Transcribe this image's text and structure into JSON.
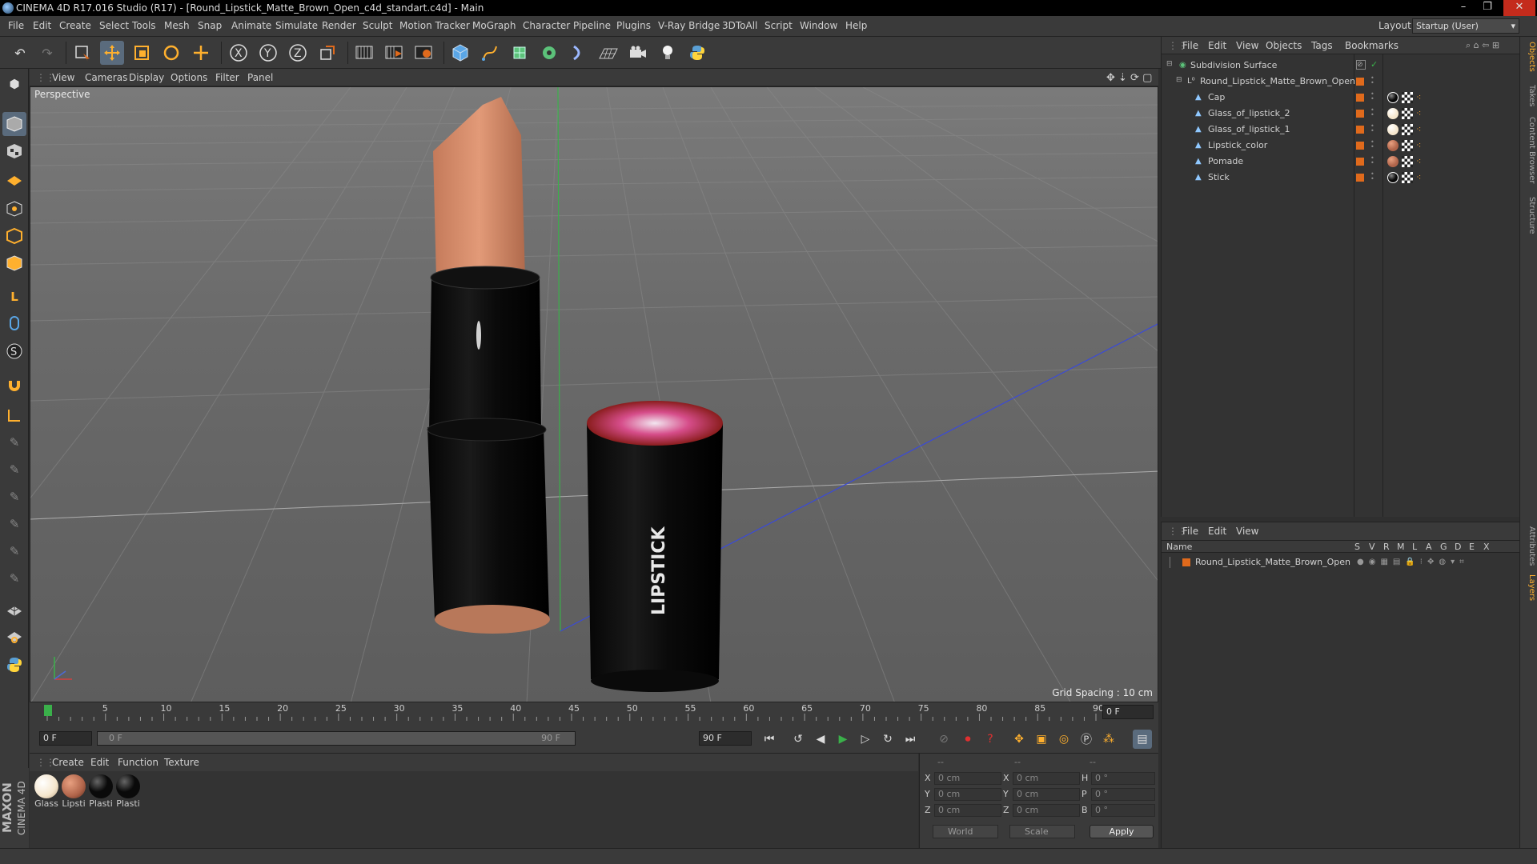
{
  "window": {
    "title": "CINEMA 4D R17.016 Studio (R17) - [Round_Lipstick_Matte_Brown_Open_c4d_standart.c4d] - Main",
    "controls": [
      "–",
      "❐",
      "✕"
    ]
  },
  "menubar": {
    "items": [
      "File",
      "Edit",
      "Create",
      "Select",
      "Tools",
      "Mesh",
      "Snap",
      "Animate",
      "Simulate",
      "Render",
      "Sculpt",
      "Motion Tracker",
      "MoGraph",
      "Character",
      "Pipeline",
      "Plugins",
      "V-Ray Bridge",
      "3DToAll",
      "Script",
      "Window",
      "Help"
    ],
    "layout_label": "Layout:",
    "layout_value": "Startup (User)"
  },
  "viewport": {
    "menu": [
      "View",
      "Cameras",
      "Display",
      "Options",
      "Filter",
      "Panel"
    ],
    "camera_label": "Perspective",
    "grid_spacing": "Grid Spacing : 10 cm",
    "object_text": "LIPSTICK"
  },
  "timeline": {
    "ticks": [
      "0",
      "5",
      "10",
      "15",
      "20",
      "25",
      "30",
      "35",
      "40",
      "45",
      "50",
      "55",
      "60",
      "65",
      "70",
      "75",
      "80",
      "85",
      "90"
    ],
    "current_frame_right": "0 F",
    "start_field": "0 F",
    "range_start": "0 F",
    "range_end": "90 F",
    "end_field": "90 F"
  },
  "material_manager": {
    "menu": [
      "Create",
      "Edit",
      "Function",
      "Texture"
    ],
    "materials": [
      {
        "label": "Glass",
        "color": "#f5e6cc"
      },
      {
        "label": "Lipsti",
        "color": "#b0644a"
      },
      {
        "label": "Plasti",
        "color": "#0a0a0a"
      },
      {
        "label": "Plasti",
        "color": "#0a0a0a"
      }
    ],
    "brand_top": "MAXON",
    "brand_bottom": "CINEMA 4D"
  },
  "coordinates": {
    "headers": [
      "--",
      "--",
      "--"
    ],
    "rows": [
      {
        "a": "X",
        "av": "0 cm",
        "b": "X",
        "bv": "0 cm",
        "c": "H",
        "cv": "0 °"
      },
      {
        "a": "Y",
        "av": "0 cm",
        "b": "Y",
        "bv": "0 cm",
        "c": "P",
        "cv": "0 °"
      },
      {
        "a": "Z",
        "av": "0 cm",
        "b": "Z",
        "bv": "0 cm",
        "c": "B",
        "cv": "0 °"
      }
    ],
    "mode": "World",
    "scale": "Scale",
    "apply": "Apply"
  },
  "object_manager": {
    "menu": [
      "File",
      "Edit",
      "View",
      "Objects",
      "Tags",
      "Bookmarks"
    ],
    "objects": [
      {
        "name": "Subdivision Surface",
        "indent": 0
      },
      {
        "name": "Round_Lipstick_Matte_Brown_Open",
        "indent": 1
      },
      {
        "name": "Cap",
        "indent": 2,
        "tag": "#0a0a0a"
      },
      {
        "name": "Glass_of_lipstick_2",
        "indent": 2,
        "tag": "#f5e6cc"
      },
      {
        "name": "Glass_of_lipstick_1",
        "indent": 2,
        "tag": "#f5e6cc"
      },
      {
        "name": "Lipstick_color",
        "indent": 2,
        "tag": "#b0644a"
      },
      {
        "name": "Pomade",
        "indent": 2,
        "tag": "#b0644a"
      },
      {
        "name": "Stick",
        "indent": 2,
        "tag": "#0a0a0a"
      }
    ]
  },
  "layer_manager": {
    "menu": [
      "File",
      "Edit",
      "View"
    ],
    "columns": [
      "Name",
      "S",
      "V",
      "R",
      "M",
      "L",
      "A",
      "G",
      "D",
      "E",
      "X"
    ],
    "layers": [
      {
        "name": "Round_Lipstick_Matte_Brown_Open",
        "color": "#e06a1c"
      }
    ]
  },
  "right_tabs": [
    "Objects",
    "Takes",
    "Content Browser",
    "Structure",
    "Attributes",
    "Layers"
  ],
  "colors": {
    "accent": "#5a6b7d",
    "layer_orange": "#e06a1c"
  }
}
